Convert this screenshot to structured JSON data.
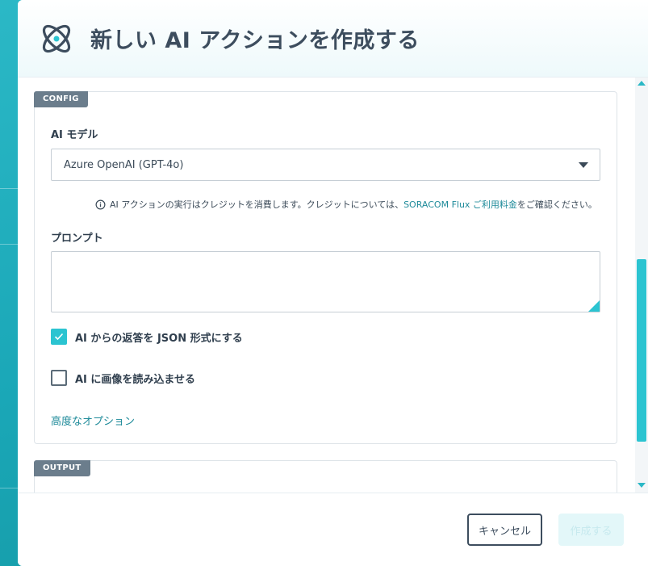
{
  "header": {
    "title": "新しい AI アクションを作成する",
    "logo_icon": "atom-icon"
  },
  "config": {
    "tag": "CONFIG",
    "model_label": "AI モデル",
    "model_selected": "Azure OpenAI (GPT-4o)",
    "notice_prefix": "AI アクションの実行はクレジットを消費します。クレジットについては、",
    "notice_link": "SORACOM Flux ご利用料金",
    "notice_suffix": "をご確認ください。",
    "prompt_label": "プロンプト",
    "prompt_value": "",
    "json_checkbox_label": "AI からの返答を JSON 形式にする",
    "json_checkbox_checked": true,
    "image_checkbox_label": "AI に画像を読み込ませる",
    "image_checkbox_checked": false,
    "advanced_link": "高度なオプション"
  },
  "output": {
    "tag": "OUTPUT"
  },
  "footer": {
    "cancel_label": "キャンセル",
    "create_label": "作成する"
  },
  "colors": {
    "accent": "#2bc4d1",
    "link": "#1f8b9a",
    "text": "#2f3e4d",
    "tag_bg": "#6b7d8c"
  }
}
